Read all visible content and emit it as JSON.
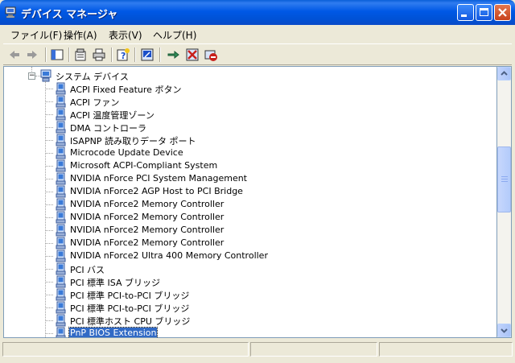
{
  "window": {
    "title": "デバイス マネージャ"
  },
  "menu": [
    "ファイル(F)",
    "操作(A)",
    "表示(V)",
    "ヘルプ(H)"
  ],
  "tree": {
    "root_label": "システム デバイス",
    "items": [
      "ACPI Fixed Feature ボタン",
      "ACPI ファン",
      "ACPI 温度管理ゾーン",
      "DMA コントローラ",
      "ISAPNP 読み取りデータ ポート",
      "Microcode Update Device",
      "Microsoft ACPI-Compliant System",
      "NVIDIA nForce PCI System Management",
      "NVIDIA nForce2 AGP Host to PCI Bridge",
      "NVIDIA nForce2 Memory Controller",
      "NVIDIA nForce2 Memory Controller",
      "NVIDIA nForce2 Memory Controller",
      "NVIDIA nForce2 Memory Controller",
      "NVIDIA nForce2 Ultra 400 Memory Controller",
      "PCI バス",
      "PCI 標準 ISA ブリッジ",
      "PCI 標準 PCI-to-PCI ブリッジ",
      "PCI 標準 PCI-to-PCI ブリッジ",
      "PCI 標準ホスト CPU ブリッジ",
      "PnP BIOS Extension"
    ],
    "selected_index": 19
  },
  "icons": {
    "toolbar": [
      "back-arrow-icon",
      "forward-arrow-icon",
      "show-hide-console-tree-icon",
      "properties-icon",
      "print-icon",
      "help-icon",
      "scan-hardware-changes-icon",
      "update-driver-icon",
      "uninstall-icon",
      "disable-device-icon"
    ]
  }
}
